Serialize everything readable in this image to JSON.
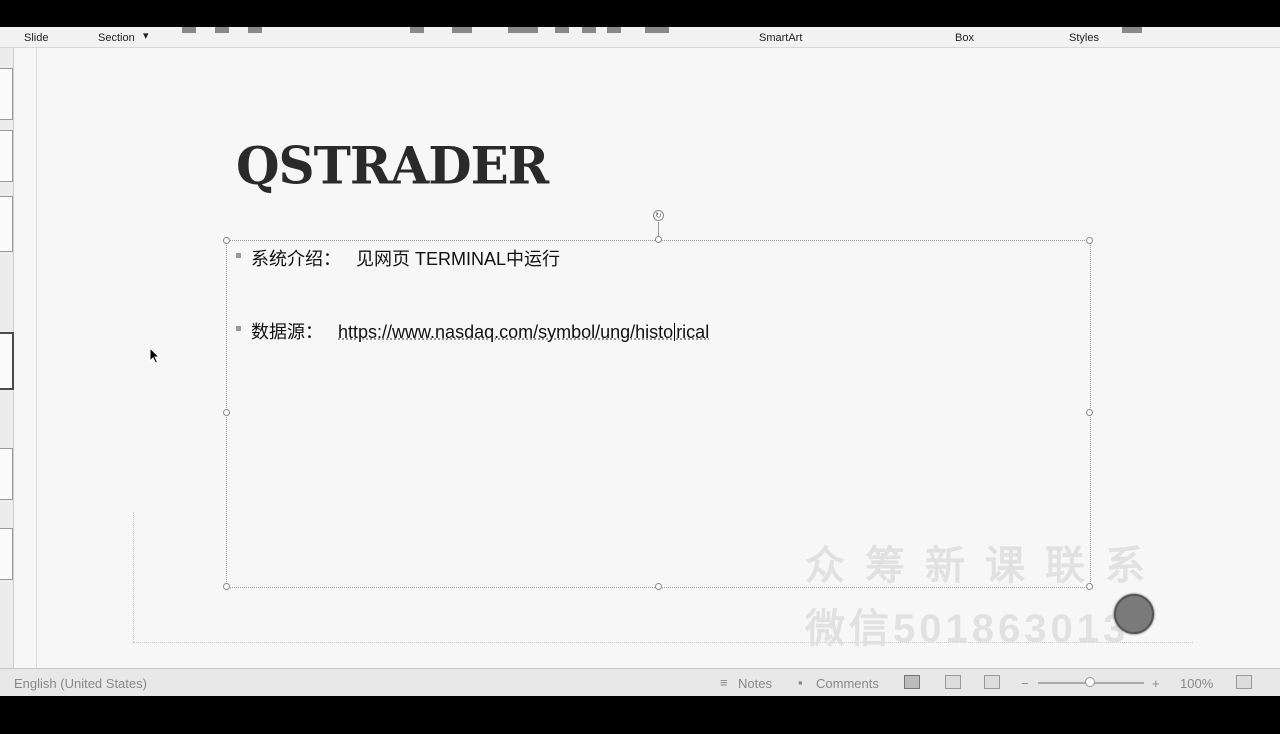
{
  "ribbon": {
    "slide_label": "Slide",
    "section_label": "Section",
    "smartart_label": "SmartArt",
    "box_label": "Box",
    "styles_label": "Styles"
  },
  "slide": {
    "title": "QSTRADER",
    "bullets": [
      {
        "label": "系统介绍：",
        "text": "见网页 TERMINAL中运行"
      },
      {
        "label": "数据源：",
        "url_before_caret": "https://www.nasdaq.com/symbol/ung/histo",
        "url_after_caret": "rical"
      }
    ]
  },
  "watermark": {
    "line1": "众筹新课联系",
    "line2": "微信501863013"
  },
  "statusbar": {
    "language": "English (United States)",
    "notes": "Notes",
    "comments": "Comments",
    "zoom": "100%",
    "zoom_minus": "−",
    "zoom_plus": "+"
  },
  "icons": {
    "rotate": "rotate-handle-icon",
    "notes": "notes-icon",
    "comments": "comments-icon",
    "normal_view": "normal-view-icon",
    "sorter_view": "slide-sorter-icon",
    "reading_view": "reading-view-icon",
    "fit": "fit-to-window-icon"
  }
}
